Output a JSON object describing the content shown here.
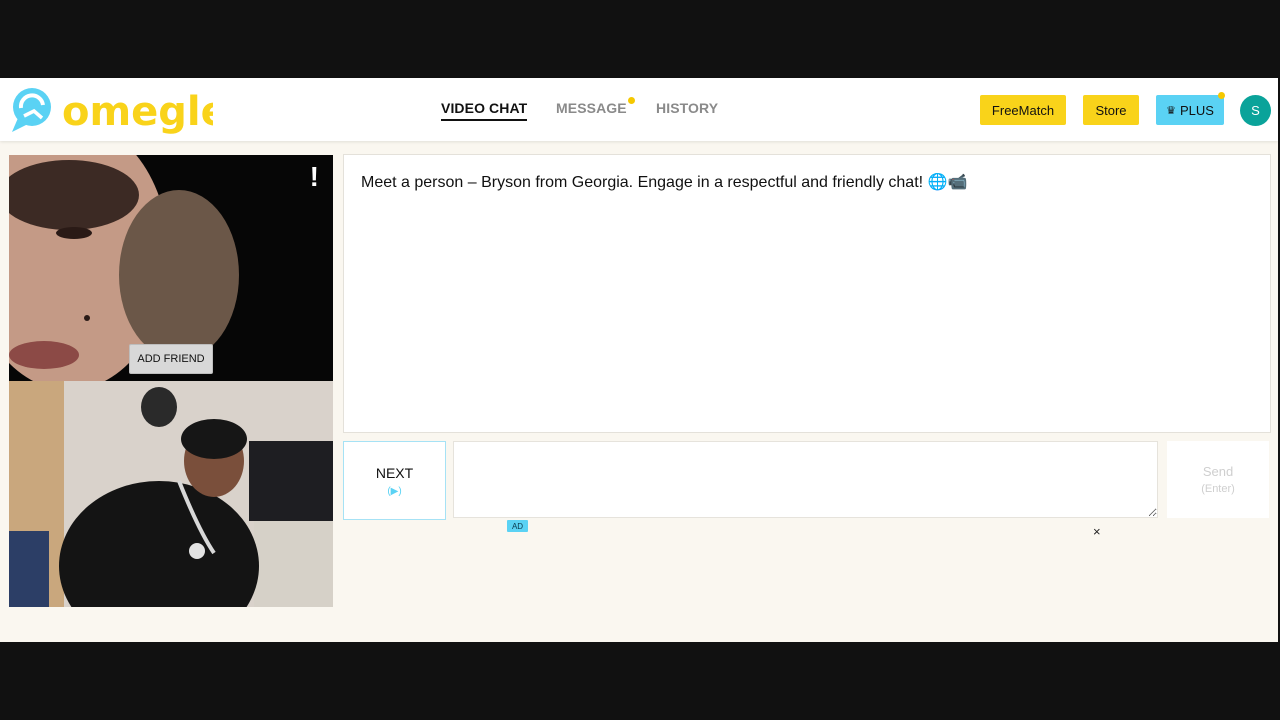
{
  "brand": {
    "name": "omegle",
    "logo_color": "#f9d31a",
    "icon_color": "#5ad2f4"
  },
  "nav": {
    "video_chat": "VIDEO CHAT",
    "message": "MESSAGE",
    "history": "HISTORY"
  },
  "header_buttons": {
    "freematch": "FreeMatch",
    "store": "Store",
    "plus_icon": "♛",
    "plus": "PLUS"
  },
  "user": {
    "initial": "S",
    "avatar_color": "#0aa39a"
  },
  "stranger_video": {
    "report_symbol": "!",
    "add_friend": "ADD FRIEND"
  },
  "chat": {
    "message": "Meet a person – Bryson from Georgia. Engage in a respectful and friendly chat! 🌐📹"
  },
  "controls": {
    "next": "NEXT",
    "next_hint": "(▶)",
    "message_placeholder": "",
    "send": "Send",
    "send_hint": "(Enter)"
  },
  "ad": {
    "badge": "AD",
    "close": "×"
  }
}
